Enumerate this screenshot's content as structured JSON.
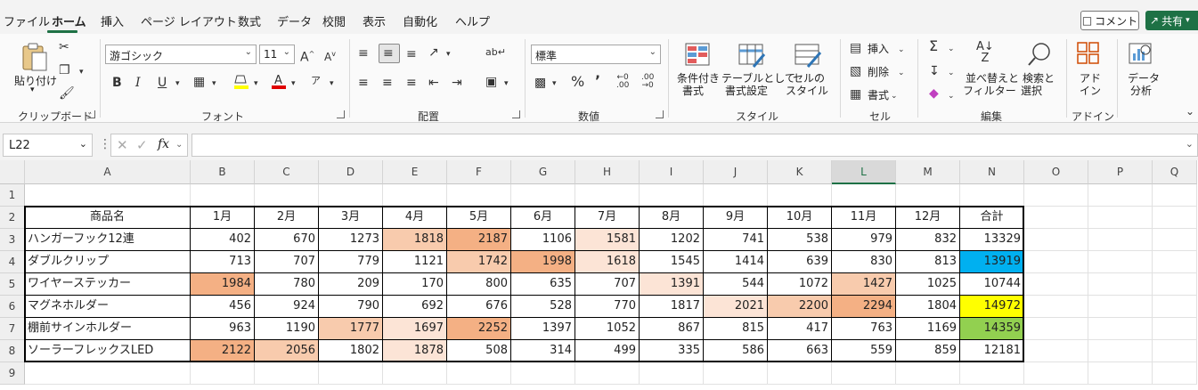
{
  "menu": {
    "tabs": [
      "ファイル",
      "ホーム",
      "挿入",
      "ページ レイアウト",
      "数式",
      "データ",
      "校閲",
      "表示",
      "自動化",
      "ヘルプ"
    ],
    "active_tab": "ホーム",
    "comment_label": "コメント",
    "share_label": "共有"
  },
  "ribbon": {
    "clipboard": {
      "paste_label": "貼り付け",
      "group_label": "クリップボード"
    },
    "font": {
      "font_name": "游ゴシック",
      "font_size": "11",
      "group_label": "フォント"
    },
    "alignment": {
      "group_label": "配置"
    },
    "number": {
      "format": "標準",
      "group_label": "数値"
    },
    "styles": {
      "conditional_label_1": "条件付き",
      "conditional_label_2": "書式",
      "table_label_1": "テーブルとして",
      "table_label_2": "書式設定",
      "cell_style_label_1": "セルの",
      "cell_style_label_2": "スタイル",
      "group_label": "スタイル"
    },
    "cells": {
      "insert_label": "挿入",
      "delete_label": "削除",
      "format_label": "書式",
      "group_label": "セル"
    },
    "editing": {
      "sort_label_1": "並べ替えと",
      "sort_label_2": "フィルター",
      "find_label_1": "検索と",
      "find_label_2": "選択",
      "group_label": "編集"
    },
    "addins": {
      "label_1": "アド",
      "label_2": "イン",
      "group_label": "アドイン"
    },
    "analysis": {
      "label_1": "データ",
      "label_2": "分析"
    }
  },
  "formula_bar": {
    "name_box": "L22",
    "formula": ""
  },
  "sheet": {
    "columns": [
      "A",
      "B",
      "C",
      "D",
      "E",
      "F",
      "G",
      "H",
      "I",
      "J",
      "K",
      "L",
      "M",
      "N",
      "O",
      "P",
      "Q"
    ],
    "selected_column": "L",
    "rows": [
      "1",
      "2",
      "3",
      "4",
      "5",
      "6",
      "7",
      "8",
      "9"
    ],
    "header": [
      "商品名",
      "1月",
      "2月",
      "3月",
      "4月",
      "5月",
      "6月",
      "7月",
      "8月",
      "9月",
      "10月",
      "11月",
      "12月",
      "合計"
    ],
    "data": [
      [
        "ハンガーフック12連",
        "402",
        "670",
        "1273",
        "1818",
        "2187",
        "1106",
        "1581",
        "1202",
        "741",
        "538",
        "979",
        "832",
        "13329"
      ],
      [
        "ダブルクリップ",
        "713",
        "707",
        "779",
        "1121",
        "1742",
        "1998",
        "1618",
        "1545",
        "1414",
        "639",
        "830",
        "813",
        "13919"
      ],
      [
        "ワイヤーステッカー",
        "1984",
        "780",
        "209",
        "170",
        "800",
        "635",
        "707",
        "1391",
        "544",
        "1072",
        "1427",
        "1025",
        "10744"
      ],
      [
        "マグネホルダー",
        "456",
        "924",
        "790",
        "692",
        "676",
        "528",
        "770",
        "1817",
        "2021",
        "2200",
        "2294",
        "1804",
        "14972"
      ],
      [
        "棚前サインホルダー",
        "963",
        "1190",
        "1777",
        "1697",
        "2252",
        "1397",
        "1052",
        "867",
        "815",
        "417",
        "763",
        "1169",
        "14359"
      ],
      [
        "ソーラーフレックスLED",
        "2122",
        "2056",
        "1802",
        "1878",
        "508",
        "314",
        "499",
        "335",
        "586",
        "663",
        "559",
        "859",
        "12181"
      ]
    ],
    "highlight_colors": {
      "light": "#fce4d6",
      "medium": "#f8cbad",
      "dark": "#f4b084",
      "total_max": "#ffff00",
      "total_second": "#92d050",
      "total_third": "#00b0f0"
    },
    "highlights": [
      [
        "",
        "",
        "",
        "medium",
        "dark",
        "",
        "light",
        "",
        "",
        "",
        "",
        "",
        ""
      ],
      [
        "",
        "",
        "",
        "",
        "medium",
        "dark",
        "light",
        "",
        "",
        "",
        "",
        "",
        ""
      ],
      [
        "dark",
        "",
        "",
        "",
        "",
        "",
        "",
        "light",
        "",
        "",
        "medium",
        "",
        ""
      ],
      [
        "",
        "",
        "",
        "",
        "",
        "",
        "",
        "",
        "light",
        "medium",
        "dark",
        "",
        ""
      ],
      [
        "",
        "",
        "medium",
        "light",
        "dark",
        "",
        "",
        "",
        "",
        "",
        "",
        "",
        ""
      ],
      [
        "dark",
        "medium",
        "",
        "light",
        "",
        "",
        "",
        "",
        "",
        "",
        "",
        "",
        ""
      ]
    ],
    "total_highlights": [
      "",
      "total_third",
      "",
      "total_max",
      "total_second",
      ""
    ]
  }
}
